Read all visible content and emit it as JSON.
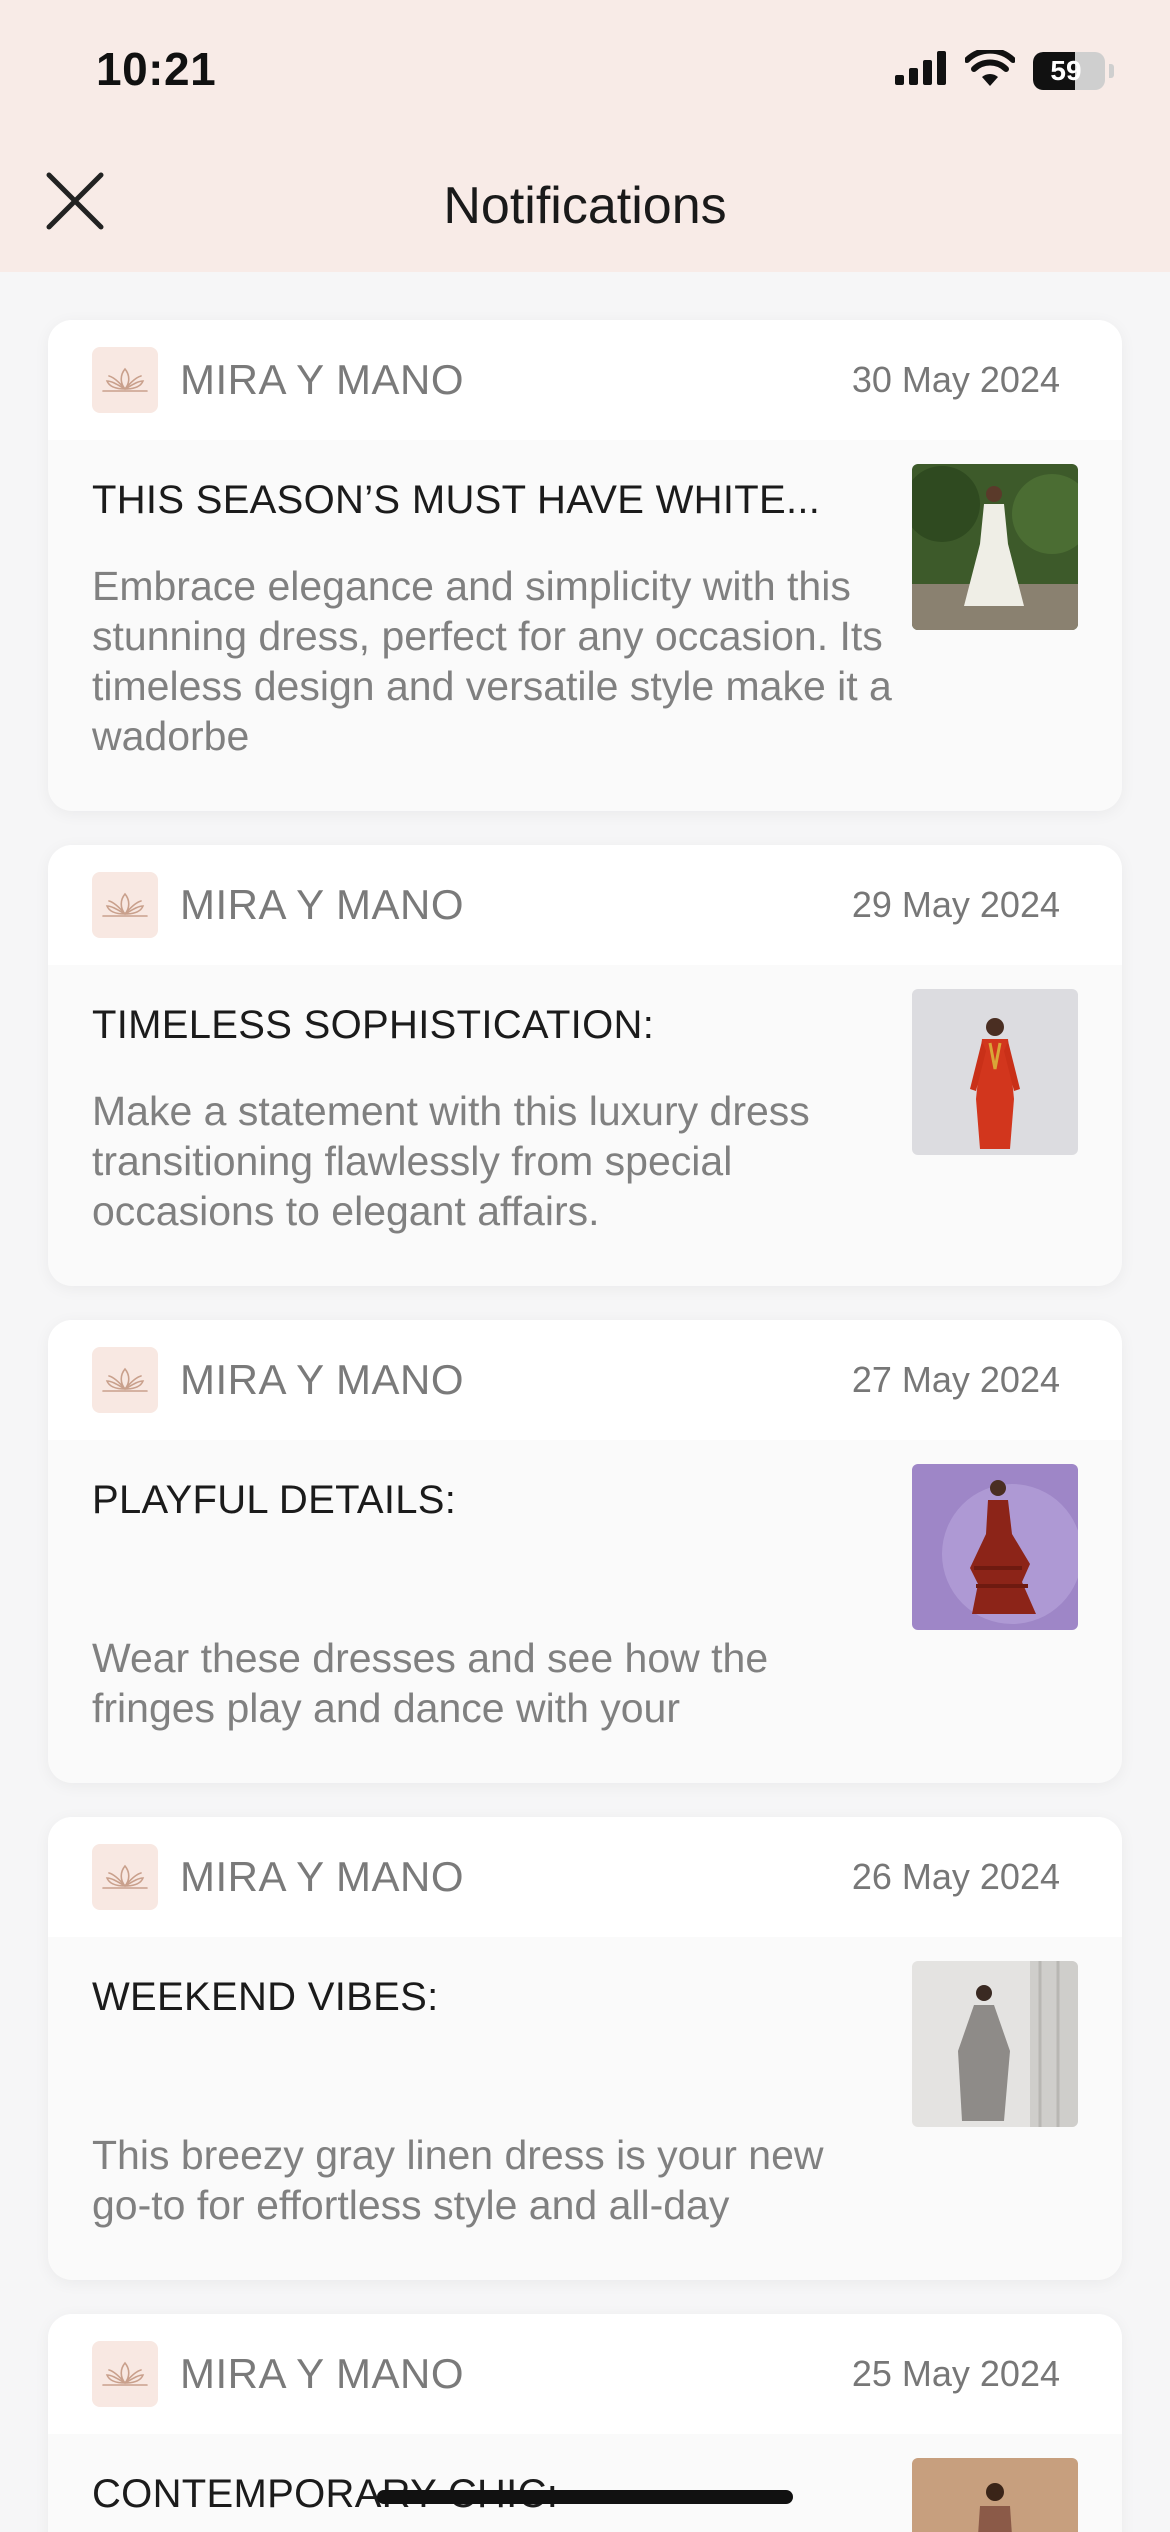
{
  "status_bar": {
    "time": "10:21",
    "battery": "59",
    "battery_level": 0.59,
    "icons": [
      "signal-icon",
      "wifi-icon",
      "battery-icon"
    ]
  },
  "header": {
    "title": "Notifications",
    "close_icon": "close-icon"
  },
  "colors": {
    "header_bg": "#f8ebe7",
    "logo_bg": "#f8e8e2",
    "logo_stroke": "#c9a08c"
  },
  "notifications": [
    {
      "brand": "MIRA Y MANO",
      "date": "30 May 2024",
      "title": "THIS SEASON’S MUST HAVE WHITE...",
      "text": "Embrace elegance and simplicity with this stunning dress, perfect for any occasion. Its timeless design and versatile style make it a wadorbe",
      "thumb_icon": "white-dress-photo"
    },
    {
      "brand": "MIRA Y MANO",
      "date": "29 May 2024",
      "title": "TIMELESS SOPHISTICATION:",
      "text": "Make a statement with this luxury dress transitioning flawlessly from special occasions to elegant affairs.",
      "thumb_icon": "red-dress-photo"
    },
    {
      "brand": "MIRA Y MANO",
      "date": "27 May 2024",
      "title": "PLAYFUL DETAILS:",
      "text": "Wear these dresses and see how the fringes play and dance with your",
      "thumb_icon": "fringe-dress-photo"
    },
    {
      "brand": "MIRA Y MANO",
      "date": "26 May 2024",
      "title": "WEEKEND VIBES:",
      "text": "This breezy gray linen dress is your new go-to for effortless style and all-day",
      "thumb_icon": "gray-dress-photo"
    },
    {
      "brand": "MIRA Y MANO",
      "date": "25 May 2024",
      "title": "CONTEMPORARY CHIC:",
      "text": "",
      "thumb_icon": "brown-dress-photo"
    }
  ]
}
